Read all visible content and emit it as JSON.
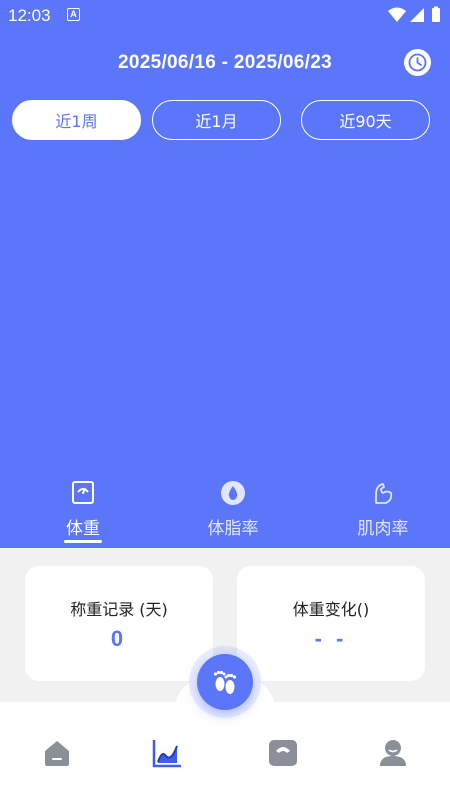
{
  "status_bar": {
    "time": "12:03",
    "app_badge": "A"
  },
  "header": {
    "date_range": "2025/06/16 - 2025/06/23",
    "clock_icon": "clock-icon"
  },
  "range_tabs": [
    {
      "label": "近1周",
      "active": true
    },
    {
      "label": "近1月",
      "active": false
    },
    {
      "label": "近90天",
      "active": false
    }
  ],
  "metric_tabs": [
    {
      "label": "体重",
      "icon": "scale-icon",
      "active": true
    },
    {
      "label": "体脂率",
      "icon": "drop-icon",
      "active": false
    },
    {
      "label": "肌肉率",
      "icon": "muscle-icon",
      "active": false
    }
  ],
  "cards": {
    "record": {
      "title": "称重记录 (天)",
      "value": "0"
    },
    "change": {
      "title": "体重变化()",
      "value": "- -"
    }
  },
  "bottom_nav": [
    {
      "icon": "home-icon",
      "active": false
    },
    {
      "icon": "chart-icon",
      "active": true
    },
    {
      "icon": "scale-device-icon",
      "active": false
    },
    {
      "icon": "profile-icon",
      "active": false
    }
  ],
  "fab": {
    "icon": "footprints-icon"
  },
  "colors": {
    "accent": "#5b76f9",
    "background": "#f1f1f1",
    "nav_icon": "#8a8f99"
  }
}
